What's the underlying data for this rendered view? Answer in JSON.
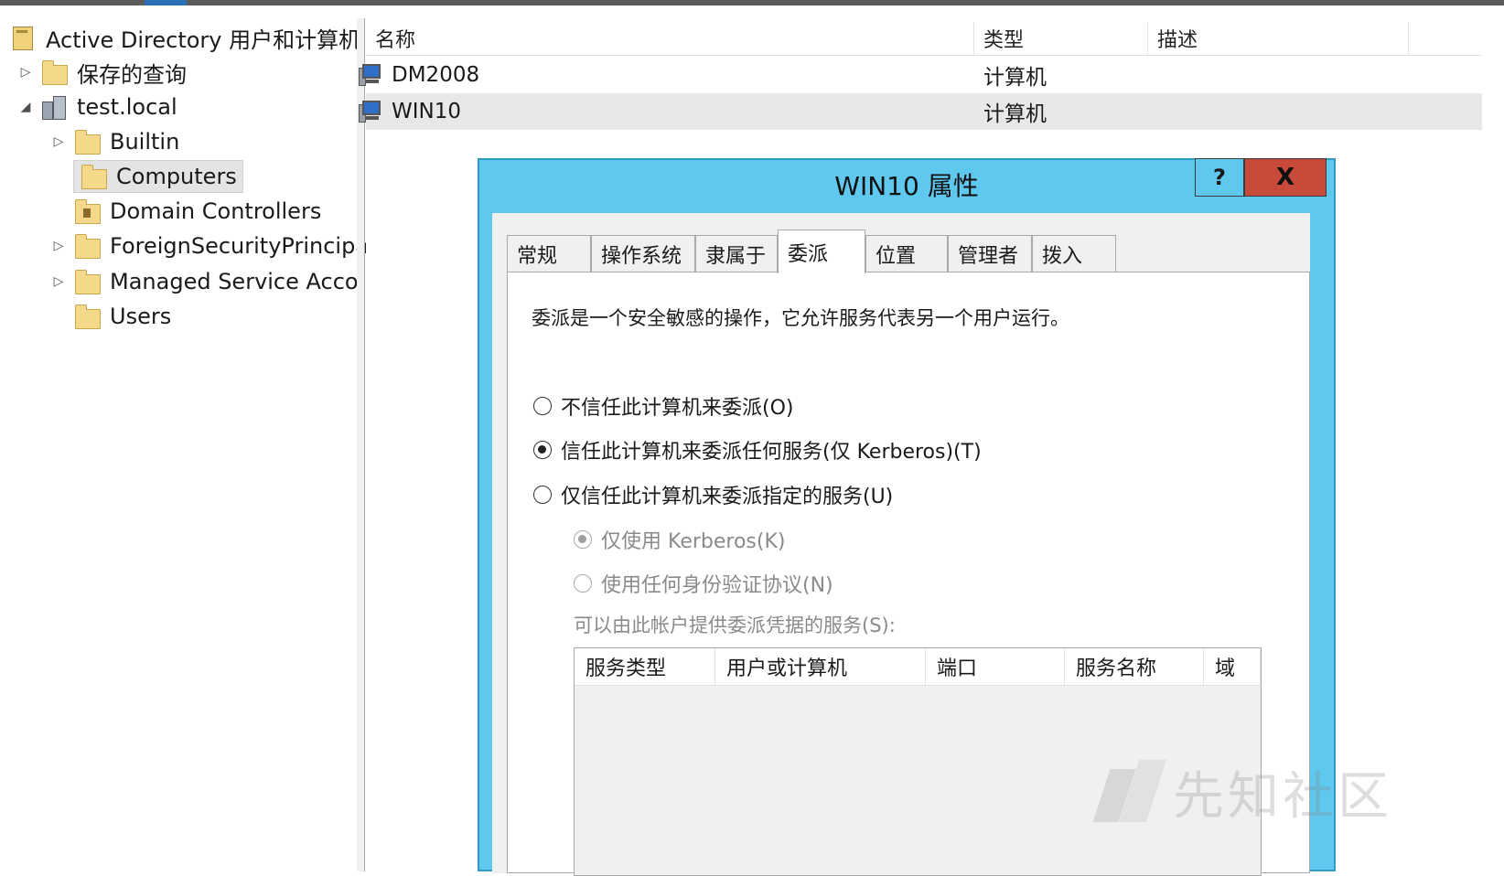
{
  "tree": {
    "items": [
      {
        "label": "Active Directory 用户和计算机",
        "expander": "",
        "icon": "ad-root-icon"
      },
      {
        "label": "保存的查询",
        "expander": "▷",
        "icon": "folder-icon"
      },
      {
        "label": "test.local",
        "expander": "◢",
        "icon": "domain-icon"
      },
      {
        "label": "Builtin",
        "expander": "▷",
        "icon": "folder-icon"
      },
      {
        "label": "Computers",
        "expander": "",
        "icon": "folder-icon"
      },
      {
        "label": "Domain Controllers",
        "expander": "",
        "icon": "ou-folder-icon"
      },
      {
        "label": "ForeignSecurityPrincipa",
        "expander": "▷",
        "icon": "folder-icon"
      },
      {
        "label": "Managed Service Acco",
        "expander": "▷",
        "icon": "folder-icon"
      },
      {
        "label": "Users",
        "expander": "",
        "icon": "folder-icon"
      }
    ]
  },
  "list": {
    "headers": [
      "名称",
      "类型",
      "描述"
    ],
    "rows": [
      {
        "name": "DM2008",
        "type": "计算机",
        "desc": ""
      },
      {
        "name": "WIN10",
        "type": "计算机",
        "desc": ""
      }
    ]
  },
  "dialog": {
    "title": "WIN10 属性",
    "help": "?",
    "close": "X",
    "tabs": [
      "常规",
      "操作系统",
      "隶属于",
      "委派",
      "位置",
      "管理者",
      "拨入"
    ],
    "active_tab": "委派",
    "description": "委派是一个安全敏感的操作，它允许服务代表另一个用户运行。",
    "options": {
      "no_trust": "不信任此计算机来委派(O)",
      "trust_any": "信任此计算机来委派任何服务(仅 Kerberos)(T)",
      "trust_specified": "仅信任此计算机来委派指定的服务(U)",
      "kerberos_only": "仅使用 Kerberos(K)",
      "any_protocol": "使用任何身份验证协议(N)"
    },
    "selected_option": "trust_any",
    "services_label": "可以由此帐户提供委派凭据的服务(S):",
    "services_headers": [
      "服务类型",
      "用户或计算机",
      "端口",
      "服务名称",
      "域"
    ]
  },
  "watermark": {
    "text": "先知社区"
  }
}
